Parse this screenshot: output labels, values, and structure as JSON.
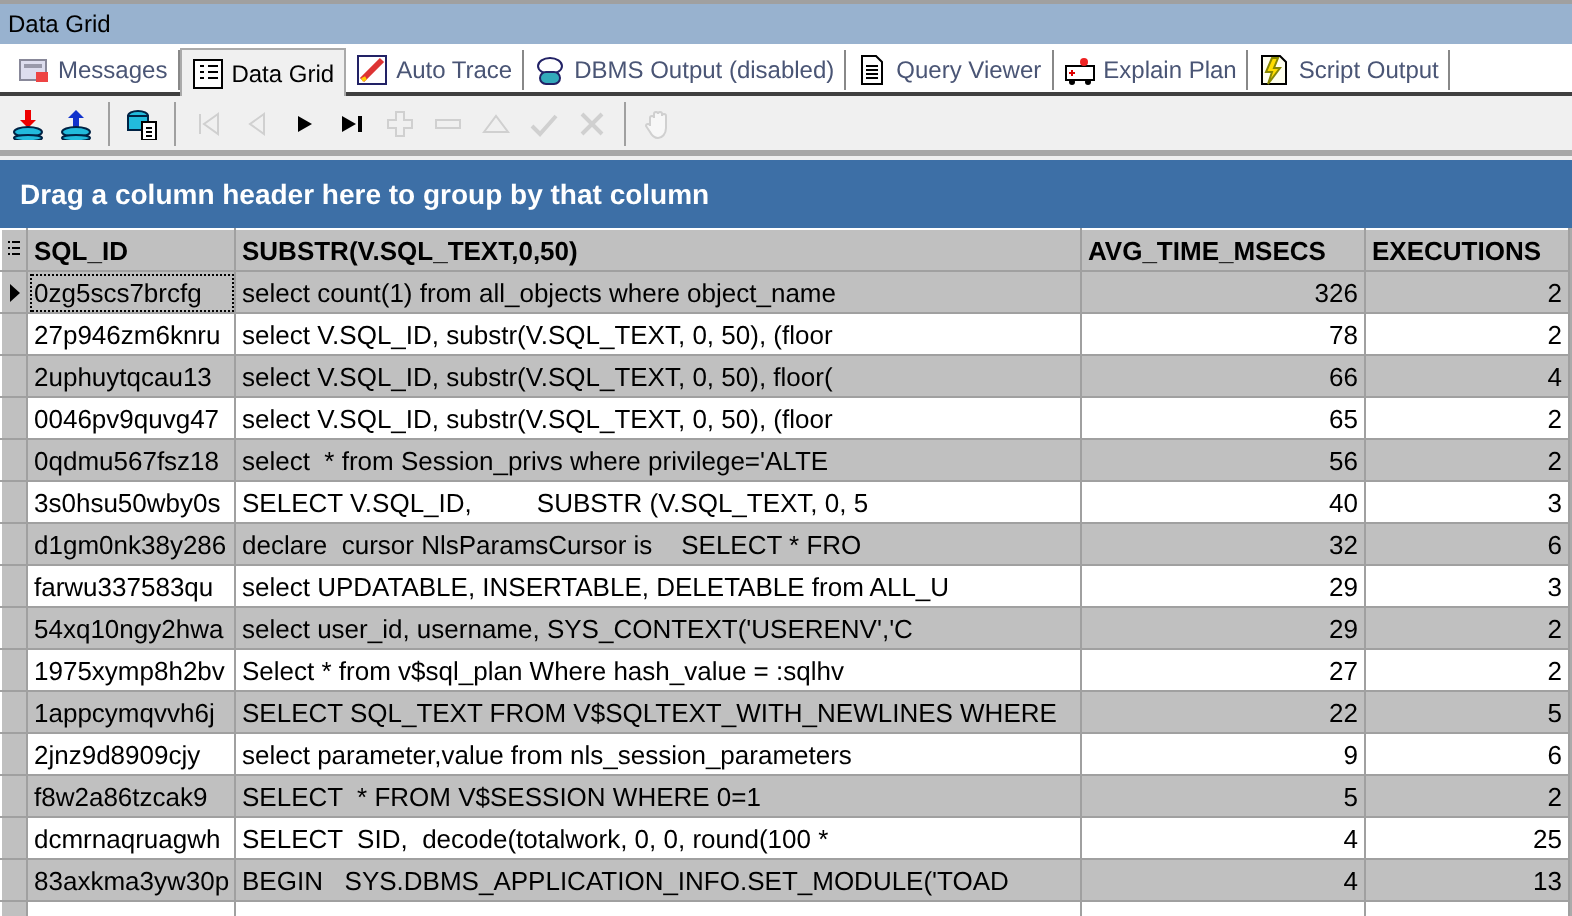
{
  "window": {
    "title": "Data Grid"
  },
  "tabs": [
    {
      "label": "Messages",
      "kind": "messages",
      "selected": false
    },
    {
      "label": "Data Grid",
      "kind": "grid",
      "selected": true
    },
    {
      "label": "Auto Trace",
      "kind": "trace",
      "selected": false
    },
    {
      "label": "DBMS Output (disabled)",
      "kind": "dbms",
      "selected": false
    },
    {
      "label": "Query Viewer",
      "kind": "doc",
      "selected": false
    },
    {
      "label": "Explain Plan",
      "kind": "ambulance",
      "selected": false
    },
    {
      "label": "Script Output",
      "kind": "script",
      "selected": false
    }
  ],
  "toolbar": [
    {
      "kind": "import",
      "disabled": false
    },
    {
      "kind": "export",
      "disabled": false
    },
    {
      "kind": "sep"
    },
    {
      "kind": "copy",
      "disabled": false
    },
    {
      "kind": "sep"
    },
    {
      "kind": "first",
      "disabled": true
    },
    {
      "kind": "prev",
      "disabled": true
    },
    {
      "kind": "next",
      "disabled": false
    },
    {
      "kind": "last",
      "disabled": false
    },
    {
      "kind": "add",
      "disabled": true
    },
    {
      "kind": "remove",
      "disabled": true
    },
    {
      "kind": "up",
      "disabled": true
    },
    {
      "kind": "check",
      "disabled": true
    },
    {
      "kind": "cancel",
      "disabled": true
    },
    {
      "kind": "sep"
    },
    {
      "kind": "hand",
      "disabled": true
    }
  ],
  "group_panel": {
    "text": "Drag a column header here to group by that column"
  },
  "table": {
    "columns": [
      {
        "label": "SQL_ID",
        "kind": "text"
      },
      {
        "label": "SUBSTR(V.SQL_TEXT,0,50)",
        "kind": "text"
      },
      {
        "label": "AVG_TIME_MSECS",
        "kind": "number"
      },
      {
        "label": "EXECUTIONS",
        "kind": "number"
      }
    ],
    "rows": [
      {
        "selected": true,
        "cells": [
          "0zg5scs7brcfg",
          "select count(1) from all_objects where object_name",
          "326",
          "2"
        ]
      },
      {
        "selected": false,
        "cells": [
          "27p946zm6knru",
          "select V.SQL_ID, substr(V.SQL_TEXT, 0, 50), (floor",
          "78",
          "2"
        ]
      },
      {
        "selected": false,
        "cells": [
          "2uphuytqcau13",
          "select V.SQL_ID, substr(V.SQL_TEXT, 0, 50), floor(",
          "66",
          "4"
        ]
      },
      {
        "selected": false,
        "cells": [
          "0046pv9quvg47",
          "select V.SQL_ID, substr(V.SQL_TEXT, 0, 50), (floor",
          "65",
          "2"
        ]
      },
      {
        "selected": false,
        "cells": [
          "0qdmu567fsz18",
          "select  * from Session_privs where privilege='ALTE",
          "56",
          "2"
        ]
      },
      {
        "selected": false,
        "cells": [
          "3s0hsu50wby0s",
          "SELECT V.SQL_ID,         SUBSTR (V.SQL_TEXT, 0, 5",
          "40",
          "3"
        ]
      },
      {
        "selected": false,
        "cells": [
          "d1gm0nk38y286",
          "declare  cursor NlsParamsCursor is    SELECT * FRO",
          "32",
          "6"
        ]
      },
      {
        "selected": false,
        "cells": [
          "farwu337583qu",
          "select UPDATABLE, INSERTABLE, DELETABLE from ALL_U",
          "29",
          "3"
        ]
      },
      {
        "selected": false,
        "cells": [
          "54xq10ngy2hwa",
          "select user_id, username, SYS_CONTEXT('USERENV','C",
          "29",
          "2"
        ]
      },
      {
        "selected": false,
        "cells": [
          "1975xymp8h2bv",
          "Select * from v$sql_plan Where hash_value = :sqlhv",
          "27",
          "2"
        ]
      },
      {
        "selected": false,
        "cells": [
          "1appcymqvvh6j",
          "SELECT SQL_TEXT FROM V$SQLTEXT_WITH_NEWLINES WHERE",
          "22",
          "5"
        ]
      },
      {
        "selected": false,
        "cells": [
          "2jnz9d8909cjy",
          "select parameter,value from nls_session_parameters",
          "9",
          "6"
        ]
      },
      {
        "selected": false,
        "cells": [
          "f8w2a86tzcak9",
          "SELECT  * FROM V$SESSION WHERE 0=1",
          "5",
          "2"
        ]
      },
      {
        "selected": false,
        "cells": [
          "dcmrnaqruagwh",
          "SELECT  SID,  decode(totalwork, 0, 0, round(100 *",
          "4",
          "25"
        ]
      },
      {
        "selected": false,
        "cells": [
          "83axkma3yw30p",
          "BEGIN   SYS.DBMS_APPLICATION_INFO.SET_MODULE('TOAD",
          "4",
          "13"
        ]
      }
    ]
  }
}
